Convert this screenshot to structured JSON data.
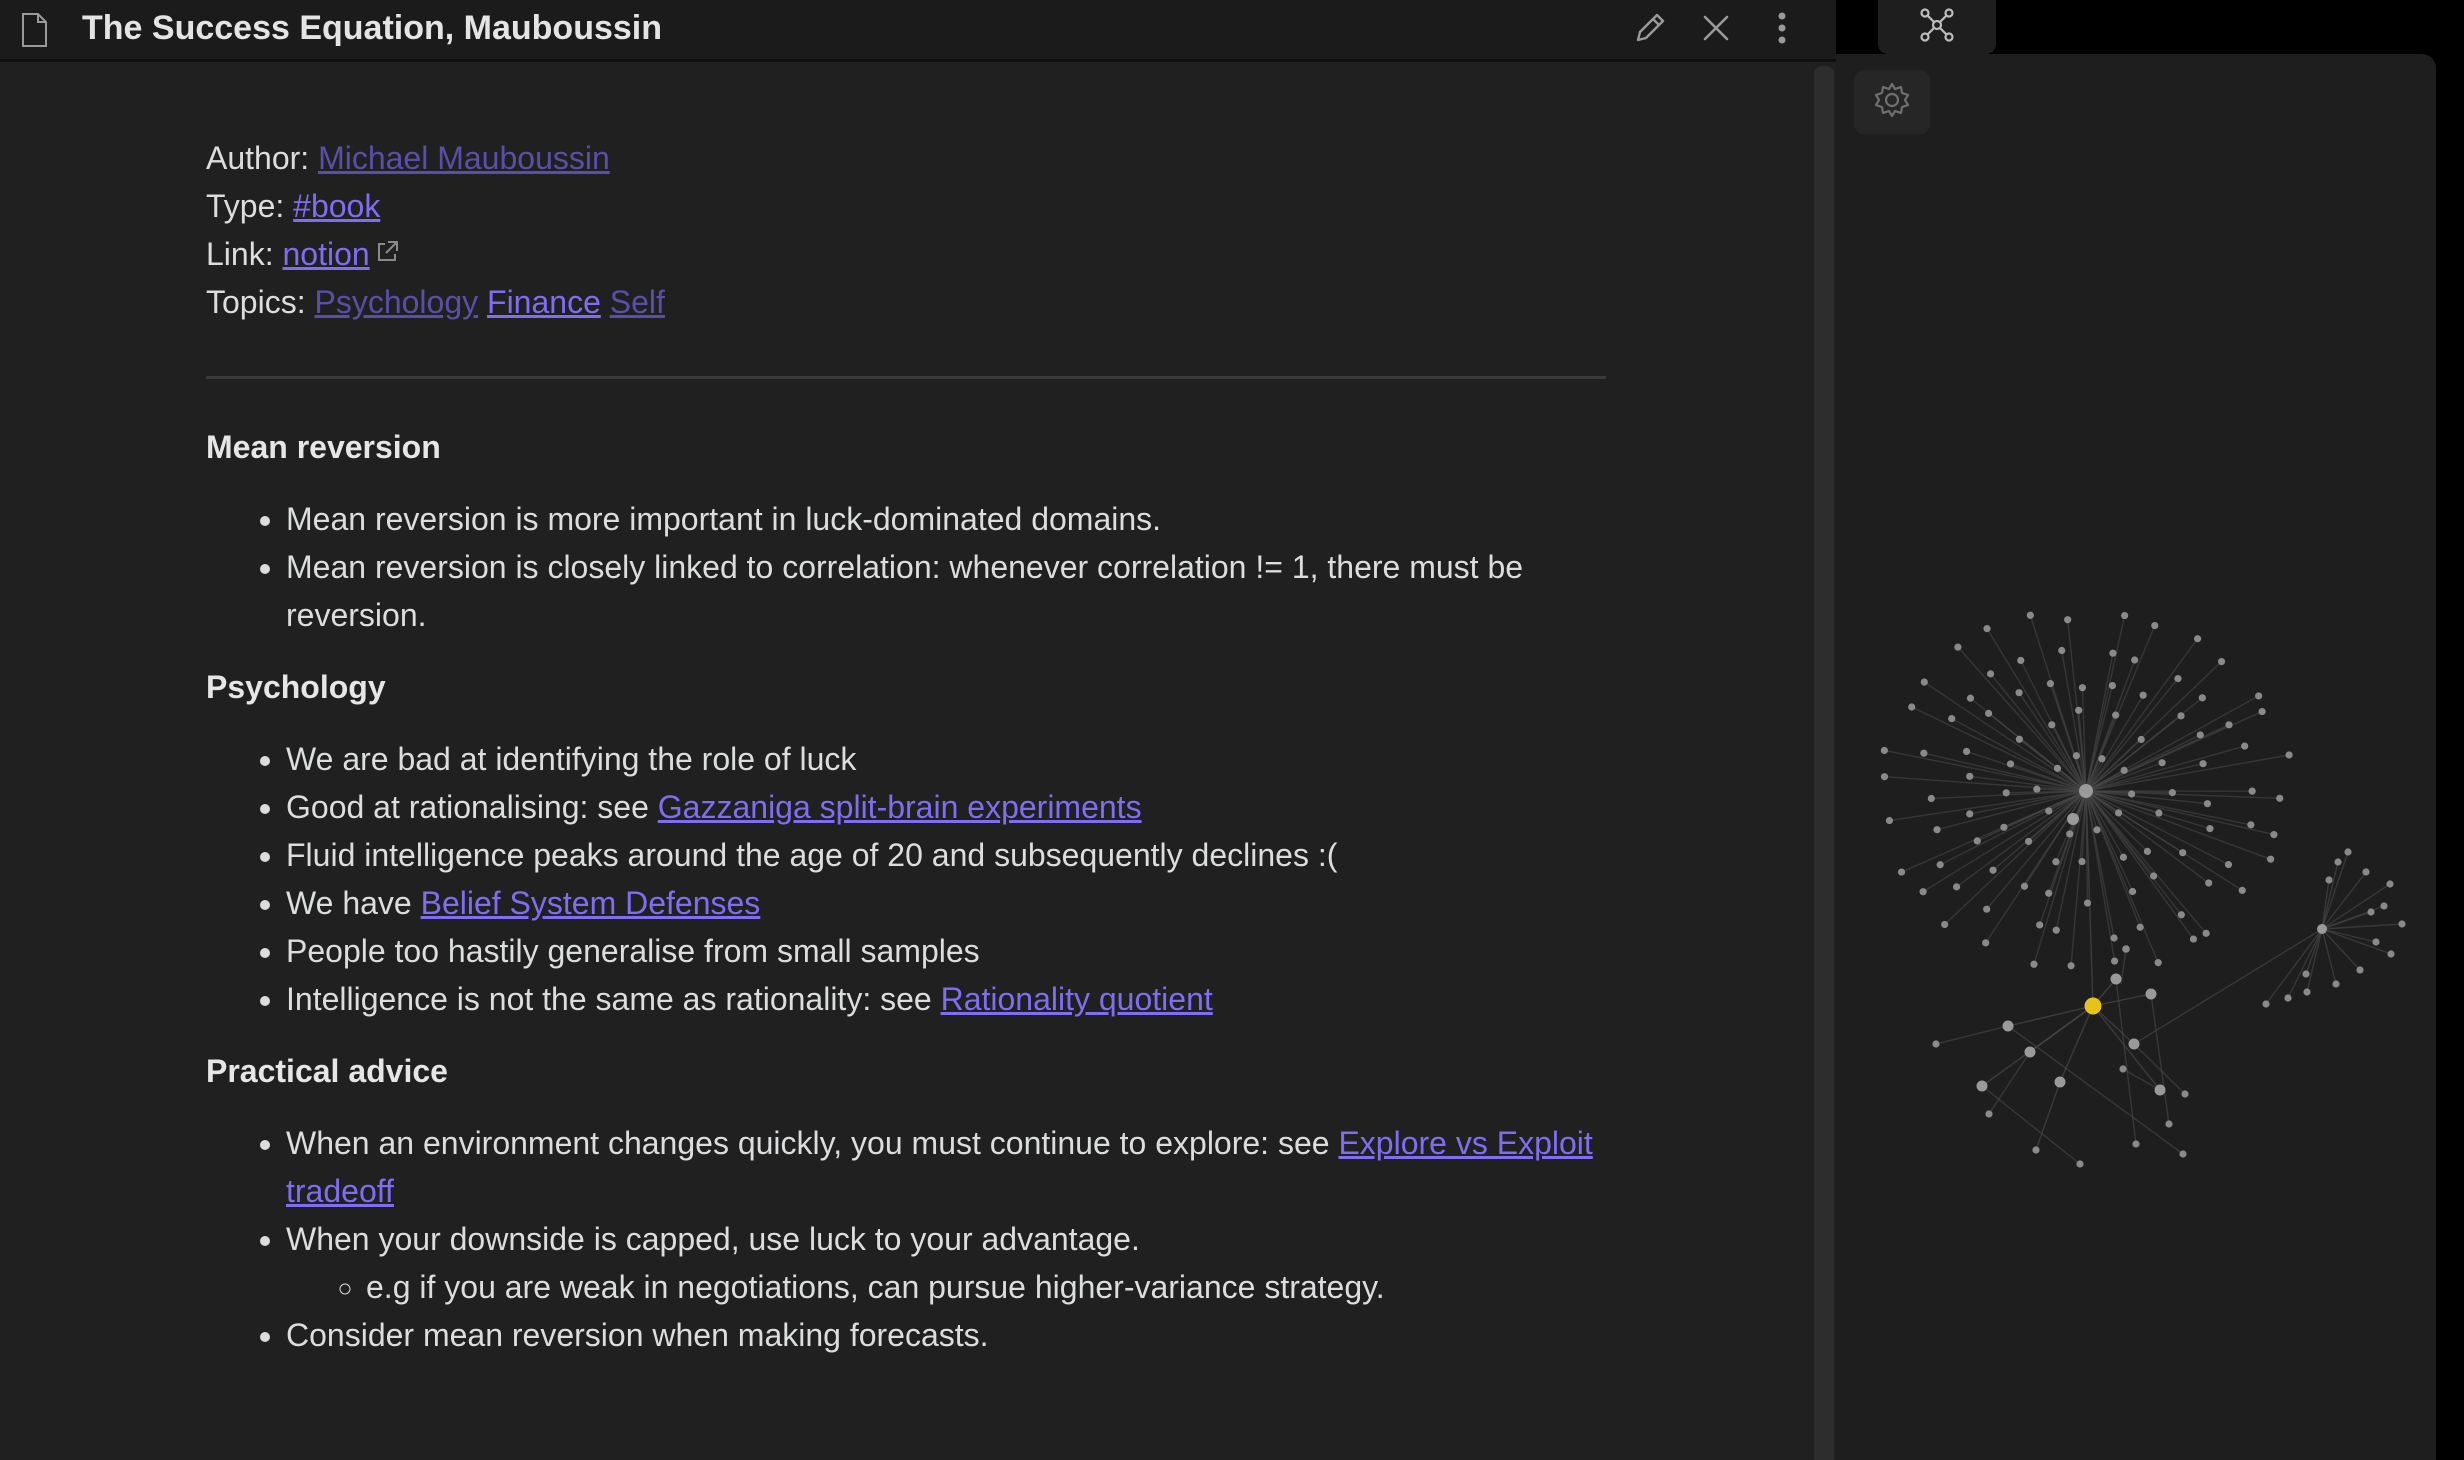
{
  "note": {
    "title": "The Success Equation, Mauboussin",
    "meta": {
      "author_label": "Author:",
      "author_link": "Michael Mauboussin",
      "type_label": "Type:",
      "type_link": "#book",
      "link_label": "Link:",
      "link_text": "notion",
      "topics_label": "Topics:",
      "topics": [
        "Psychology",
        "Finance",
        "Self"
      ]
    },
    "sections": {
      "mean_reversion": {
        "heading": "Mean reversion",
        "items": [
          "Mean reversion is more important in luck-dominated domains.",
          "Mean reversion is closely linked to correlation: whenever correlation != 1, there must be reversion."
        ]
      },
      "psychology": {
        "heading": "Psychology",
        "item1": "We are bad at identifying the role of luck",
        "item2_prefix": "Good at rationalising: see ",
        "item2_link": "Gazzaniga split-brain experiments",
        "item3": "Fluid intelligence peaks around the age of 20 and subsequently declines :(",
        "item4_prefix": "We have ",
        "item4_link": "Belief System Defenses",
        "item5": "People too hastily generalise from small samples",
        "item6_prefix": "Intelligence is not the same as rationality: see ",
        "item6_link": "Rationality quotient"
      },
      "practical": {
        "heading": "Practical advice",
        "item1_prefix": "When an environment changes quickly, you must continue to explore: see ",
        "item1_link": "Explore vs Exploit tradeoff",
        "item2": "When your downside is capped, use luck to your advantage.",
        "item2_sub": "e.g if you are weak in negotiations, can pursue higher-variance strategy.",
        "item3": "Consider mean reversion when making forecasts."
      }
    }
  },
  "colors": {
    "link": "#7f6df2",
    "link_dim": "#5a4fa8",
    "active_node": "#e8c21c",
    "node": "#8a8a8a"
  },
  "icons": {
    "file": "file-icon",
    "edit": "pencil-icon",
    "close": "close-icon",
    "more": "more-vertical-icon",
    "graph": "graph-view-icon",
    "settings": "gear-icon",
    "external": "external-link-icon"
  }
}
